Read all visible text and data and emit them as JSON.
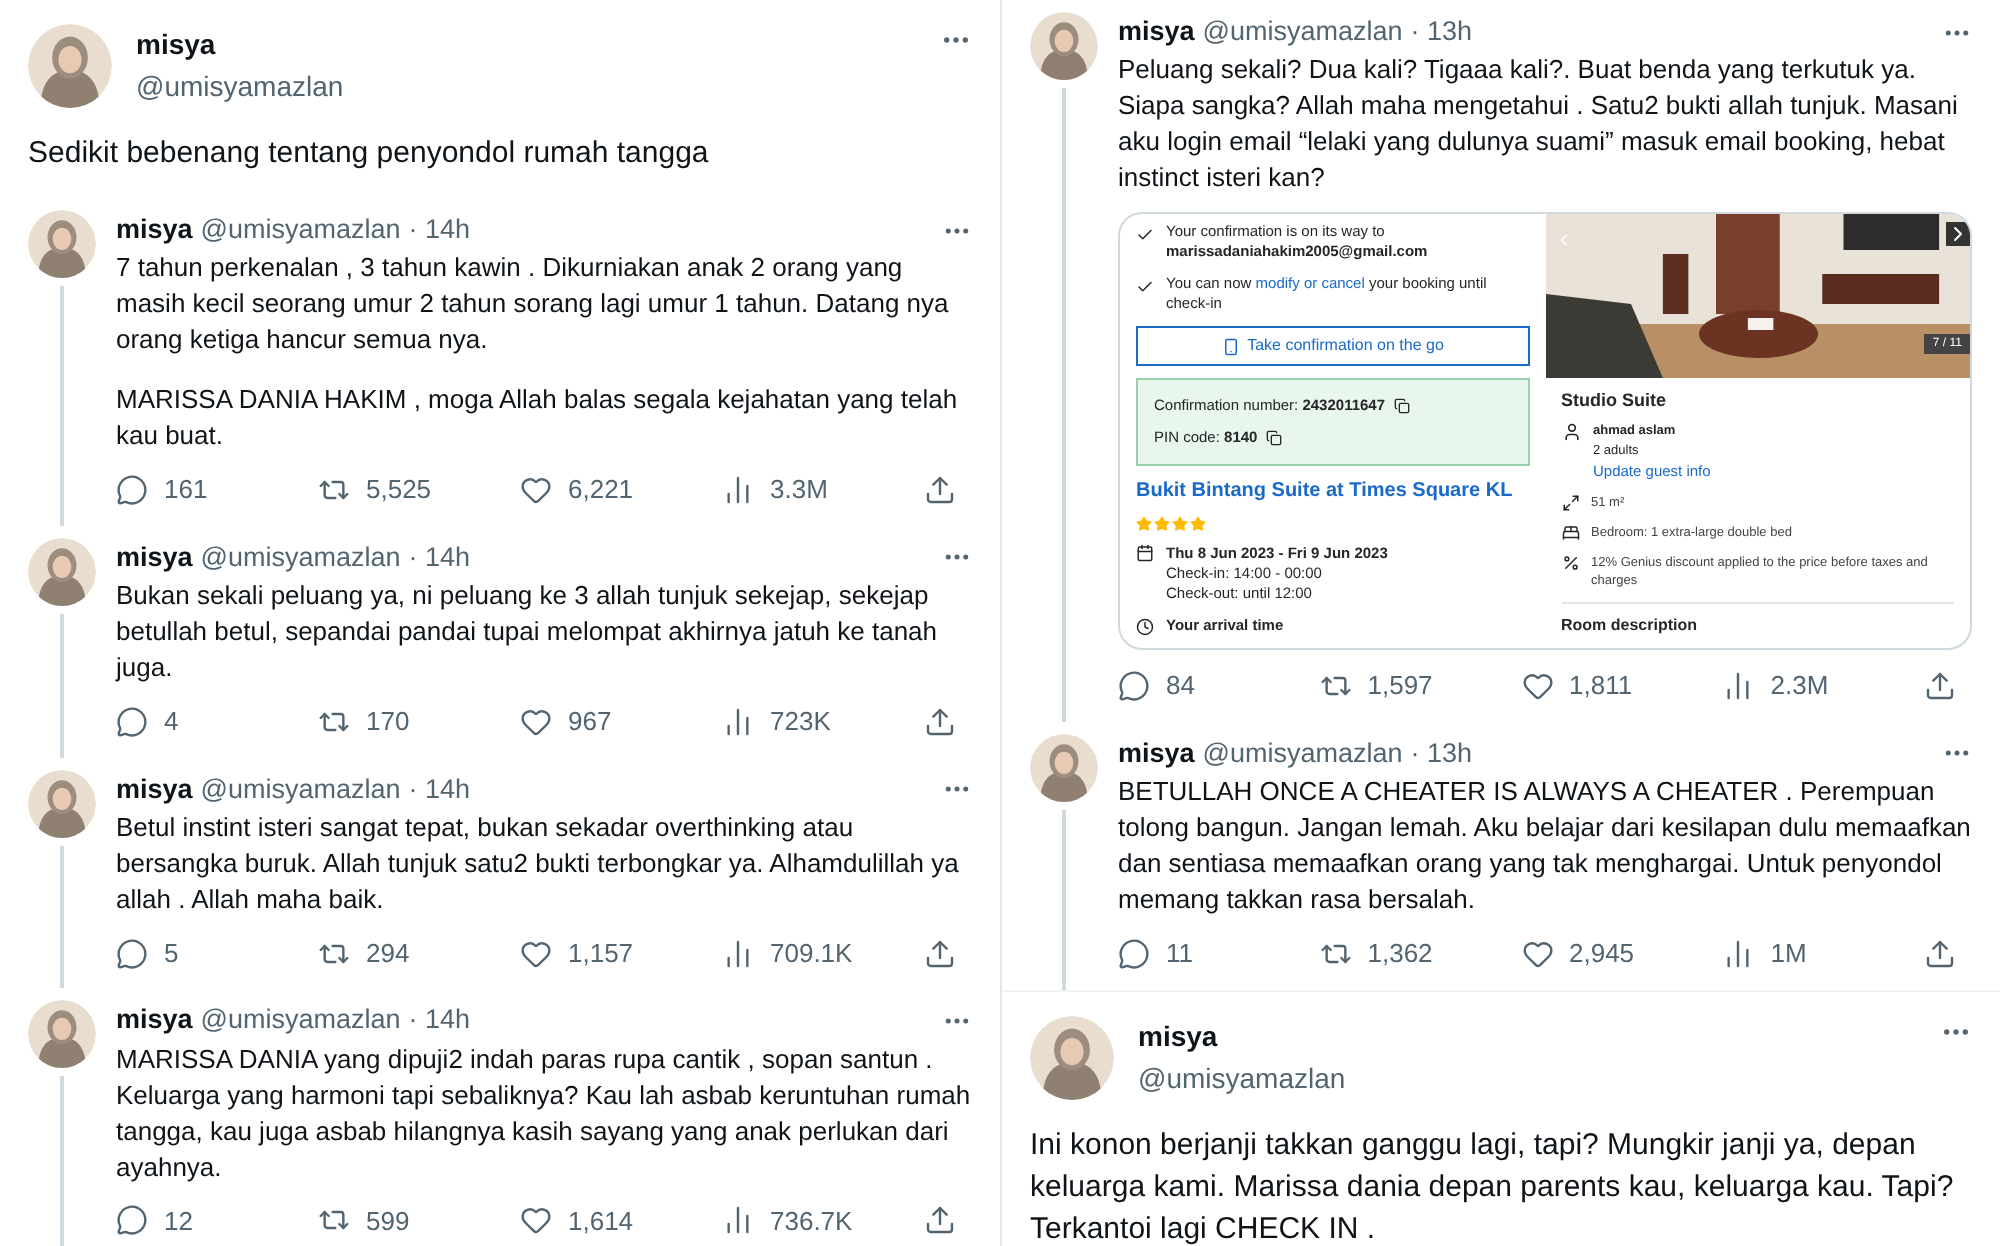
{
  "columns": [
    {
      "tweets": [
        {
          "kind": "main",
          "name": "misya",
          "handle": "@umisyamazlan",
          "paragraphs": [
            "Sedikit bebenang tentang penyondol rumah tangga"
          ]
        },
        {
          "kind": "reply",
          "name": "misya",
          "handle": "@umisyamazlan",
          "time": "· 14h",
          "paragraphs": [
            "7 tahun perkenalan , 3 tahun kawin . Dikurniakan anak 2 orang yang masih kecil seorang umur 2 tahun sorang lagi umur 1 tahun. Datang nya orang ketiga hancur semua nya.",
            "MARISSA DANIA HAKIM , moga Allah balas segala kejahatan yang telah kau buat."
          ],
          "stats": {
            "replies": "161",
            "retweets": "5,525",
            "likes": "6,221",
            "views": "3.3M"
          }
        },
        {
          "kind": "reply",
          "name": "misya",
          "handle": "@umisyamazlan",
          "time": "· 14h",
          "paragraphs": [
            "Bukan sekali peluang ya, ni peluang ke 3 allah tunjuk sekejap, sekejap betullah betul, sepandai pandai tupai melompat akhirnya jatuh ke tanah juga."
          ],
          "stats": {
            "replies": "4",
            "retweets": "170",
            "likes": "967",
            "views": "723K"
          }
        },
        {
          "kind": "reply",
          "name": "misya",
          "handle": "@umisyamazlan",
          "time": "· 14h",
          "paragraphs": [
            "Betul instint isteri sangat tepat, bukan sekadar overthinking atau bersangka buruk. Allah tunjuk satu2 bukti terbongkar ya. Alhamdulillah ya allah . Allah maha baik."
          ],
          "stats": {
            "replies": "5",
            "retweets": "294",
            "likes": "1,157",
            "views": "709.1K"
          }
        },
        {
          "kind": "reply",
          "name": "misya",
          "handle": "@umisyamazlan",
          "time": "· 14h",
          "paragraphs": [
            "MARISSA DANIA yang dipuji2 indah paras rupa cantik , sopan santun . Keluarga yang harmoni tapi sebaliknya? Kau lah asbab keruntuhan rumah tangga, kau juga asbab hilangnya kasih sayang yang anak perlukan dari ayahnya."
          ],
          "stats": {
            "replies": "12",
            "retweets": "599",
            "likes": "1,614",
            "views": "736.7K"
          }
        }
      ]
    },
    {
      "tweets": [
        {
          "kind": "reply",
          "name": "misya",
          "handle": "@umisyamazlan",
          "time": "· 13h",
          "paragraphs": [
            "Peluang sekali? Dua kali? Tigaaa kali?. Buat benda yang terkutuk ya. Siapa sangka? Allah maha mengetahui . Satu2 bukti allah tunjuk. Masani aku login email “lelaki yang dulunya suami” masuk email booking, hebat instinct isteri kan?"
          ],
          "attachment": {
            "notices": [
              {
                "kind": "email",
                "text": "Your confirmation is on its way to",
                "detail": "marissadaniahakim2005@gmail.com"
              },
              {
                "kind": "link",
                "before": "You can now",
                "link": "modify or cancel",
                "after": "your booking until check-in"
              }
            ],
            "button": "Take confirmation on the go",
            "codes": [
              {
                "label": "Confirmation number:",
                "value": "2432011647"
              },
              {
                "label": "PIN code:",
                "value": "8140"
              }
            ],
            "hotel": "Bukit Bintang Suite at Times Square KL",
            "stars": 4,
            "dates": "Thu 8 Jun 2023 - Fri 9 Jun 2023",
            "check_in": "Check-in: 14:00 - 00:00",
            "check_out": "Check-out: until 12:00",
            "arrival": "Your arrival time",
            "photo_counter": "7 / 11",
            "room": "Studio Suite",
            "guest": "ahmad aslam",
            "adults": "2 adults",
            "guest_link": "Update guest info",
            "facts": [
              {
                "kind": "size",
                "text": "51 m²"
              },
              {
                "kind": "bed",
                "text": "Bedroom: 1 extra-large double bed"
              },
              {
                "kind": "discount",
                "text": "12% Genius discount applied to the price before taxes and charges"
              }
            ],
            "section": "Room description"
          },
          "stats": {
            "replies": "84",
            "retweets": "1,597",
            "likes": "1,811",
            "views": "2.3M"
          }
        },
        {
          "kind": "reply",
          "name": "misya",
          "handle": "@umisyamazlan",
          "time": "· 13h",
          "paragraphs": [
            "BETULLAH ONCE A CHEATER IS ALWAYS A CHEATER . Perempuan tolong bangun. Jangan lemah. Aku belajar dari kesilapan dulu memaafkan dan sentiasa memaafkan orang yang tak menghargai. Untuk penyondol memang takkan rasa bersalah."
          ],
          "stats": {
            "replies": "11",
            "retweets": "1,362",
            "likes": "2,945",
            "views": "1M"
          }
        },
        {
          "kind": "main",
          "name": "misya",
          "handle": "@umisyamazlan",
          "paragraphs": [
            "Ini konon berjanji takkan ganggu lagi, tapi? Mungkir janji ya, depan keluarga kami. Marissa dania depan parents kau, keluarga kau. Tapi? Terkantoi lagi CHECK IN ."
          ]
        }
      ]
    }
  ]
}
